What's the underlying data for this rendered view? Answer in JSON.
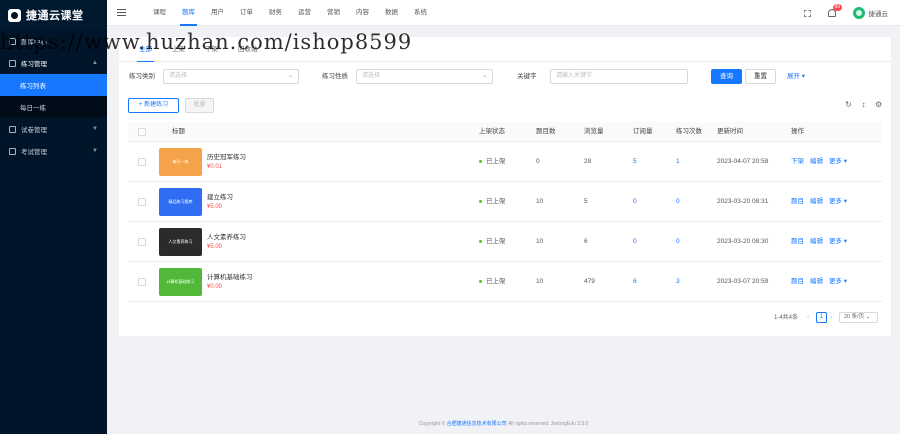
{
  "brand": {
    "name": "捷通云课堂"
  },
  "sidebar": {
    "items": [
      {
        "label": "题库中心"
      },
      {
        "label": "练习管理",
        "children": [
          {
            "label": "练习列表"
          },
          {
            "label": "每日一练"
          }
        ]
      },
      {
        "label": "试卷管理"
      },
      {
        "label": "考试管理"
      }
    ]
  },
  "topnav": {
    "items": [
      "课程",
      "题库",
      "用户",
      "订单",
      "财务",
      "运营",
      "营销",
      "内容",
      "数据",
      "系统"
    ],
    "active_index": 1
  },
  "header": {
    "notification_count": "99",
    "username": "捷通云"
  },
  "watermark": "https://www.huzhan.com/ishop8599",
  "tabs": {
    "items": [
      "全部",
      "上架",
      "下架",
      "回收站"
    ],
    "active_index": 0
  },
  "filter": {
    "type_label": "练习类别",
    "type_placeholder": "请选择",
    "nature_label": "练习性质",
    "nature_placeholder": "请选择",
    "keyword_label": "关键字",
    "keyword_placeholder": "请输入关键字",
    "search_button": "查询",
    "reset_button": "重置",
    "expand_link": "展开"
  },
  "toolbar": {
    "add_button": "+ 新建练习",
    "batch_button": "批量"
  },
  "table": {
    "headers": [
      "标题",
      "上架状态",
      "题目数",
      "浏览量",
      "订阅量",
      "练习次数",
      "更新时间",
      "操作"
    ],
    "rows": [
      {
        "thumb_text": "每日一练",
        "thumb_color": "#f5a34a",
        "title": "历史冠军练习",
        "price": "¥0.01",
        "status": "已上架",
        "questions": "0",
        "views": "28",
        "subs": "5",
        "practice": "1",
        "updated": "2023-04-07 20:58",
        "actions": [
          "下架",
          "编辑",
          "更多 ▾"
        ]
      },
      {
        "thumb_text": "精品练习题库",
        "thumb_color": "#2f6ef2",
        "title": "建立练习",
        "price": "¥5.00",
        "status": "已上架",
        "questions": "10",
        "views": "5",
        "subs": "0",
        "practice": "0",
        "updated": "2023-03-20 08:31",
        "actions": [
          "题目",
          "编辑",
          "更多 ▾"
        ]
      },
      {
        "thumb_text": "人文素养练习",
        "thumb_color": "#2b2b2b",
        "title": "人文素养练习",
        "price": "¥5.00",
        "status": "已上架",
        "questions": "10",
        "views": "6",
        "subs": "0",
        "practice": "0",
        "updated": "2023-03-20 08:30",
        "actions": [
          "题目",
          "编辑",
          "更多 ▾"
        ]
      },
      {
        "thumb_text": "计算机基础练习",
        "thumb_color": "#52b83a",
        "title": "计算机基础练习",
        "price": "¥0.00",
        "status": "已上架",
        "questions": "10",
        "views": "479",
        "subs": "6",
        "practice": "3",
        "updated": "2023-03-07 20:59",
        "actions": [
          "题目",
          "编辑",
          "更多 ▾"
        ]
      }
    ]
  },
  "pagination": {
    "total": "1-4共4条",
    "current": "1",
    "page_size": "20 条/页"
  },
  "footer": {
    "prefix": "Copyright © ",
    "company": "合肥捷通信息技术有限公司",
    "suffix": " All rights reserved. JietongEdu 3.5.0"
  }
}
